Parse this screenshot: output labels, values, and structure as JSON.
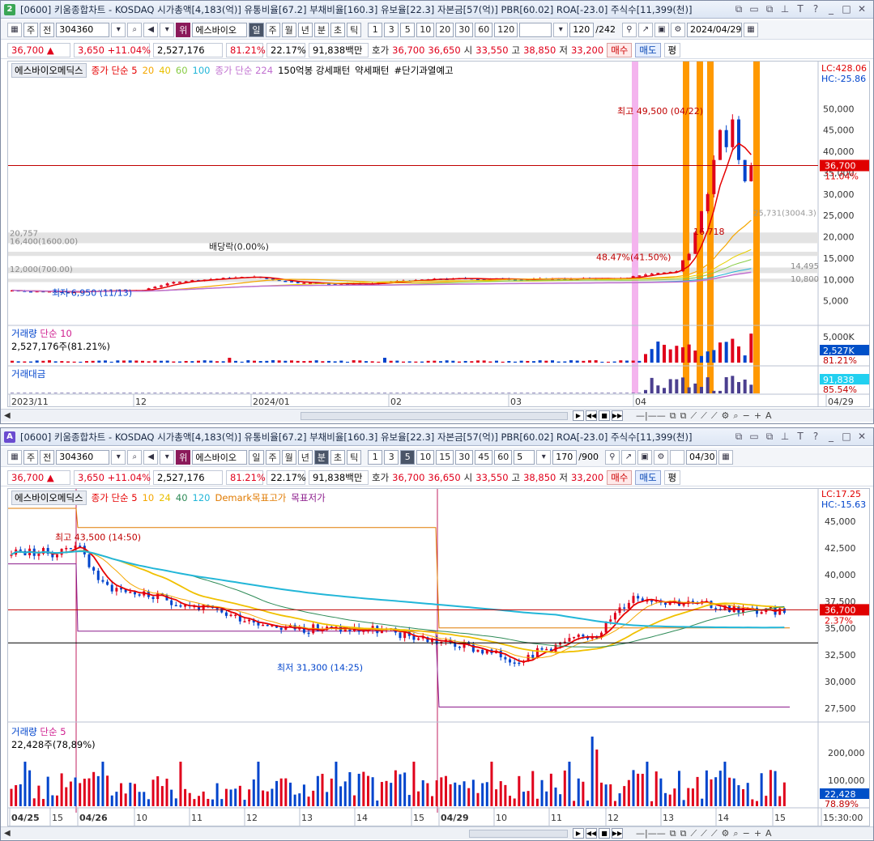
{
  "colors": {
    "up": "#e0001b",
    "down": "#0044cc",
    "ma5": "#e60000",
    "ma20": "#f5a700",
    "ma40": "#e8d000",
    "ma60": "#88cc44",
    "ma100": "#22b6d8",
    "ma224": "#c070d0",
    "signal": "#ff9900",
    "signal_pink": "#f4b4ee"
  },
  "win1": {
    "badge": "2",
    "title": "[0600] 키움종합차트 - KOSDAQ 시가총액[4,183(억)] 유통비율[67.2] 부채비율[160.3] 유보율[22.3] 자본금[57(억)] PBR[60.02] ROA[-23.0] 주식수[11,399(천)]",
    "title_icons": [
      "copy-icon",
      "minimize-icon",
      "restore-icon",
      "pin-icon",
      "font-icon",
      "help-icon",
      "min-icon",
      "max-icon",
      "close-icon"
    ],
    "toolbar": {
      "type_btn": "주",
      "prev_btn": "전",
      "code": "304360",
      "search_icon": "search-icon",
      "sound_icon": "speaker-icon",
      "badge": "위",
      "name": "에스바이오",
      "periods": [
        "일",
        "주",
        "월",
        "년",
        "분",
        "초",
        "틱"
      ],
      "active_period": "일",
      "nums": [
        "1",
        "3",
        "5",
        "10",
        "20",
        "30",
        "60",
        "120"
      ],
      "count": "120",
      "total": "/242",
      "date": "2024/04/29"
    },
    "quote": {
      "price": "36,700",
      "arrow": "▲",
      "change": "3,650",
      "pct": "+11.04%",
      "volume": "2,527,176",
      "vol_rate": "81.21%",
      "turnover": "22.17%",
      "amount": "91,838백만",
      "hoga_label": "호가",
      "ask": "36,700",
      "bid": "36,650",
      "open_label": "시",
      "open": "33,550",
      "high_label": "고",
      "high": "38,850",
      "low_label": "저",
      "low": "33,200",
      "buy": "매수",
      "sell": "매도",
      "pyeong": "평"
    },
    "legend": {
      "name": "에스바이오메딕스",
      "ma_label": "종가 단순 5",
      "ma20": "20",
      "ma40": "40",
      "ma60": "60",
      "ma100": "100",
      "ma224": "종가 단순 224",
      "s1": "150억봉 강세패턴",
      "s2": "약세패턴",
      "s3": "#단기과열예고"
    },
    "right_labels": {
      "lc": "LC:428.06",
      "hc": "HC:-25.86",
      "price_tag": "36,700",
      "pct_tag": "11.04%",
      "ma_tag": "25,731(3004.3)"
    },
    "y_ticks": [
      "50,000",
      "45,000",
      "40,000",
      "35,000",
      "30,000",
      "25,000",
      "20,000",
      "15,000",
      "10,000",
      "5,000"
    ],
    "annotations": {
      "high": "최고 49,500 (04/22)",
      "low": "최저 6,950 (11/13)",
      "div": "배당락(0.00%)",
      "pct": "48.47%(41.50%)",
      "val": "16,718",
      "lv1": "20,757",
      "lv2": "16,400(1600.00)",
      "lv3": "12,000(700.00)",
      "r1": "14,495",
      "r2": "10,800"
    },
    "vol": {
      "legend": "거래량",
      "legend2": "단순 10",
      "value": "2,527,176주(81.21%)",
      "tick": "5,000K",
      "tag": "2,527K",
      "tag2": "81.21%"
    },
    "amt": {
      "legend": "거래대금",
      "tag": "91,838",
      "tag2": "85.54%"
    },
    "xaxis": [
      "2023/11",
      "12",
      "2024/01",
      "02",
      "03",
      "04",
      "04/29"
    ]
  },
  "win2": {
    "badge": "A",
    "title": "[0600] 키움종합차트 - KOSDAQ 시가총액[4,183(억)] 유통비율[67.2] 부채비율[160.3] 유보율[22.3] 자본금[57(억)] PBR[60.02] ROA[-23.0] 주식수[11,399(천)]",
    "toolbar": {
      "type_btn": "주",
      "prev_btn": "전",
      "code": "304360",
      "badge": "위",
      "name": "에스바이오",
      "periods": [
        "일",
        "주",
        "월",
        "년",
        "분",
        "초",
        "틱"
      ],
      "active_period": "분",
      "nums": [
        "1",
        "3",
        "5",
        "10",
        "15",
        "30",
        "45",
        "60"
      ],
      "active_num": "5",
      "interval": "5",
      "count": "170",
      "total": "/900",
      "date": "04/30"
    },
    "legend": {
      "name": "에스바이오메딕스",
      "ma_label": "종가 단순 5",
      "ma10": "10",
      "ma24": "24",
      "ma40": "40",
      "ma120": "120",
      "demark_hi": "Demark목표고가",
      "demark_lo": "목표저가"
    },
    "right_labels": {
      "lc": "LC:17.25",
      "hc": "HC:-15.63",
      "price_tag": "36,700",
      "pct_tag": "2.37%"
    },
    "y_ticks": [
      "45,000",
      "42,500",
      "40,000",
      "37,500",
      "35,000",
      "32,500",
      "30,000",
      "27,500"
    ],
    "annotations": {
      "high": "최고 43,500 (14:50)",
      "low": "최저 31,300 (14:25)"
    },
    "vol": {
      "legend": "거래량",
      "legend2": "단순 5",
      "value": "22,428주(78,89%)",
      "ticks": [
        "200,000",
        "100,000"
      ],
      "tag": "22,428",
      "tag2": "78.89%"
    },
    "xaxis": [
      "04/25",
      "15",
      "04/26",
      "10",
      "11",
      "12",
      "13",
      "14",
      "15",
      "04/29",
      "10",
      "11",
      "12",
      "13",
      "14",
      "15",
      "15:30:00"
    ]
  }
}
